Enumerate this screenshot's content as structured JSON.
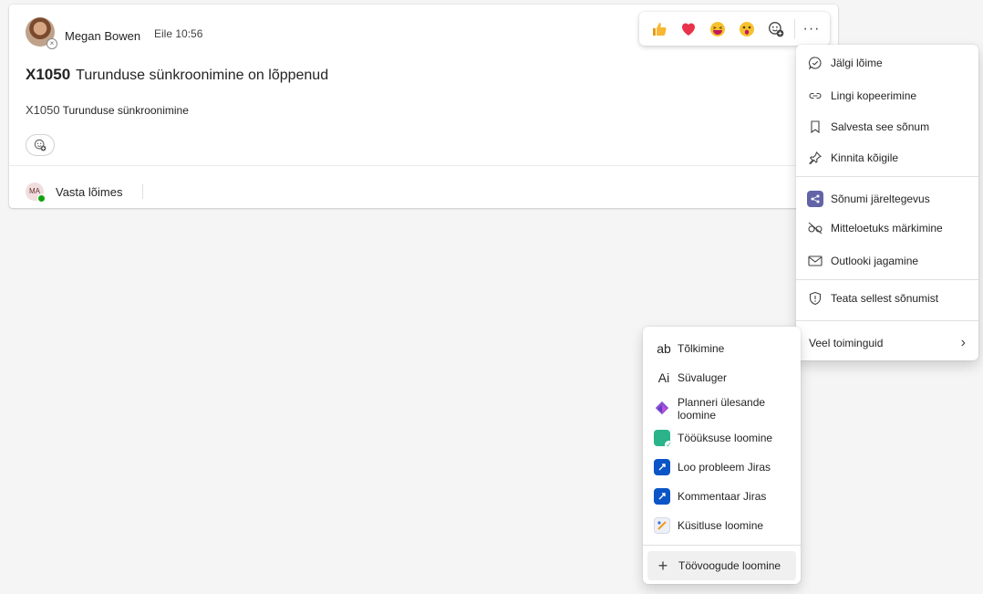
{
  "message": {
    "author": "Megan Bowen",
    "time": "Eile 10:56",
    "title_code": "X1050",
    "title_text": "Turunduse sünkroonimine on lõppenud",
    "body_code": "X1050",
    "body_text": "Turunduse sünkroonimine",
    "reply_initials": "MA",
    "reply_label": "Vasta lõimes"
  },
  "reactions": [
    "like-emoji",
    "heart-emoji",
    "laugh-emoji",
    "surprised-emoji",
    "add-reaction-icon"
  ],
  "more_label": "···",
  "context_menu": {
    "items": [
      {
        "label": "Jälgi lõime",
        "icon": "follow-thread-icon"
      },
      {
        "label": "Lingi kopeerimine",
        "icon": "link-icon"
      },
      {
        "label": "Salvesta see sõnum",
        "icon": "bookmark-icon"
      },
      {
        "label": "Kinnita kõigile",
        "icon": "pin-icon"
      },
      {
        "label": "Sõnumi järeltegevus",
        "icon": "follow-up-app-icon"
      },
      {
        "label": "Mitteloetuks märkimine",
        "icon": "unread-icon"
      },
      {
        "label": "Outlooki jagamine",
        "icon": "mail-icon"
      },
      {
        "label": "Teata sellest sõnumist",
        "icon": "shield-icon"
      },
      {
        "label": "Veel toiminguid",
        "icon": "chevron-right-icon"
      }
    ]
  },
  "submenu": {
    "items": [
      {
        "label": "Tõlkimine",
        "icon": "translate-icon",
        "glyph": "ab"
      },
      {
        "label": "Süvaluger",
        "icon": "immersive-reader-icon",
        "glyph": "Ai"
      },
      {
        "label": "Planneri ülesande loomine",
        "icon": "planner-icon"
      },
      {
        "label": "Tööüksuse loomine",
        "icon": "work-item-icon"
      },
      {
        "label": "Loo probleem Jiras",
        "icon": "jira-icon"
      },
      {
        "label": "Kommentaar Jiras",
        "icon": "jira-icon"
      },
      {
        "label": "Küsitluse loomine",
        "icon": "forms-icon"
      },
      {
        "label": "Töövoogude loomine",
        "icon": "plus-icon"
      }
    ]
  }
}
